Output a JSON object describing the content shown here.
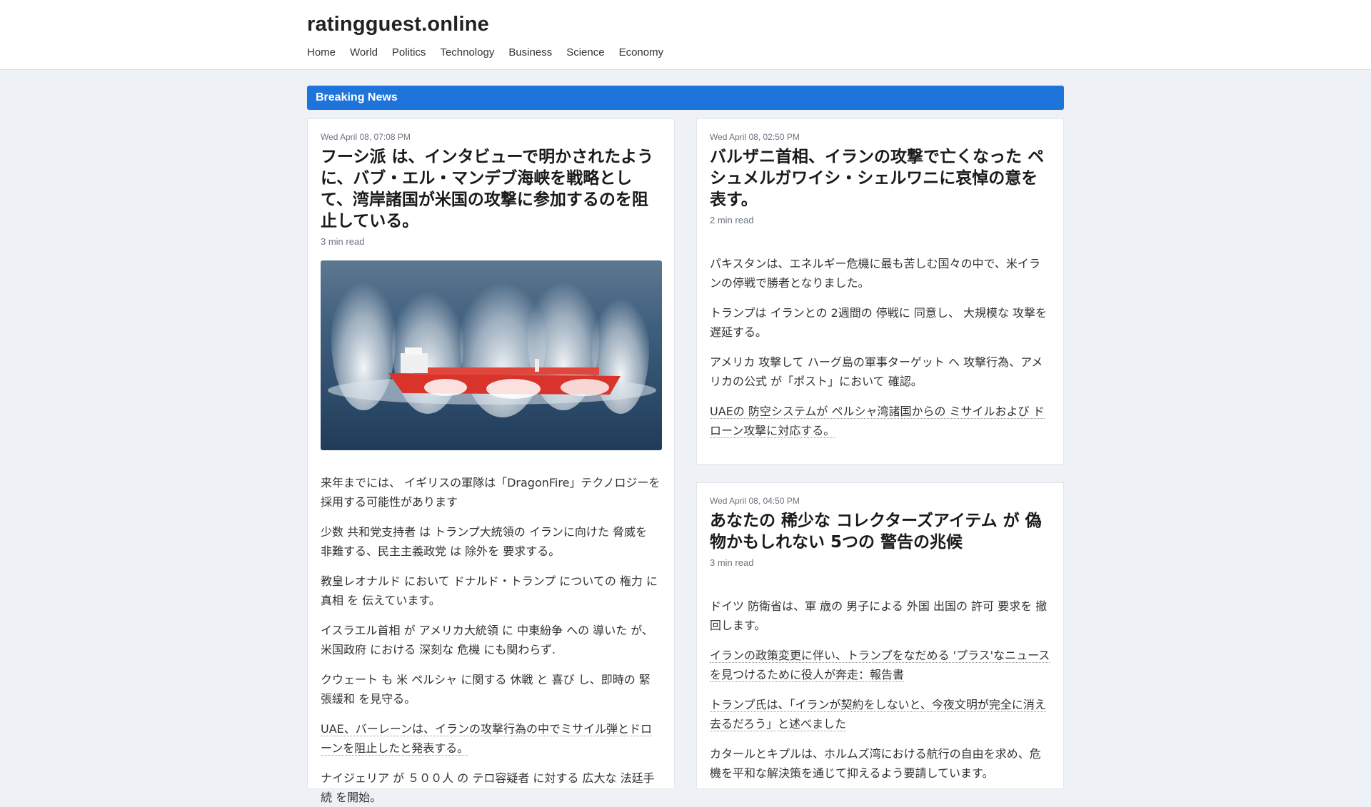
{
  "header": {
    "site_title": "ratingguest.online",
    "nav": [
      "Home",
      "World",
      "Politics",
      "Technology",
      "Business",
      "Science",
      "Economy"
    ]
  },
  "breaking": {
    "label": "Breaking News"
  },
  "cards": {
    "left": {
      "date": "Wed April 08, 07:08 PM",
      "title": "フーシ派 は、インタビューで明かされたように、バブ・エル・マンデブ海峡を戦略として、湾岸諸国が米国の攻撃に参加するのを阻止している。",
      "read_time": "3 min read",
      "items": [
        "来年までには、 イギリスの軍隊は「DragonFire」テクノロジーを採用する可能性があります",
        "少数 共和党支持者 は トランプ大統領の イランに向けた 脅威を 非難する、民主主義政党 は 除外を 要求する。",
        "教皇レオナルド において ドナルド・トランプ についての 権力 に 真相 を 伝えています。",
        "イスラエル首相 が アメリカ大統領 に 中東紛争 への 導いた が、米国政府 における 深刻な 危機 にも関わらず.",
        "クウェート も 米 ペルシャ に関する 休戦 と 喜び し、即時の 緊張緩和 を見守る。",
        "UAE、バーレーンは、イランの攻撃行為の中でミサイル弾とドローンを阻止したと発表する。",
        "ナイジェリア が ５００人 の テロ容疑者 に対する 広大な 法廷手続 を開始。"
      ]
    },
    "right_top": {
      "date": "Wed April 08, 02:50 PM",
      "title": "バルザニ首相、イランの攻撃で亡くなった ペシュメルガワイシ・シェルワニに哀悼の意を表す。",
      "read_time": "2 min read",
      "items": [
        "パキスタンは、エネルギー危機に最も苦しむ国々の中で、米イランの停戦で勝者となりました。",
        "トランプは イランとの 2週間の 停戦に 同意し、 大規模な 攻撃を 遅延する。",
        "アメリカ 攻撃して ハーグ島の軍事ターゲット へ 攻撃行為、アメリカの公式 が「ポスト」において 確認。",
        "UAEの 防空システムが ペルシャ湾諸国からの ミサイルおよび ドローン攻撃に対応する。"
      ]
    },
    "right_bottom": {
      "date": "Wed April 08, 04:50 PM",
      "title": "あなたの 稀少な コレクターズアイテム が 偽物かもしれない 5つの 警告の兆候",
      "read_time": "3 min read",
      "items": [
        "ドイツ 防衛省は、軍 歳の 男子による 外国 出国の 許可 要求を 撤回します。",
        "イランの政策変更に伴い、トランプをなだめる 'プラス'なニュースを見つけるために役人が奔走：報告書",
        "トランプ氏は、「イランが契約をしないと、今夜文明が完全に消え去るだろう」と述べました",
        "カタールとキプルは、ホルムズ湾における航行の自由を求め、危機を平和な解決策を通じて抑えるよう要請しています。"
      ]
    }
  },
  "colors": {
    "accent": "#1f74db",
    "background": "#eef1f5"
  }
}
